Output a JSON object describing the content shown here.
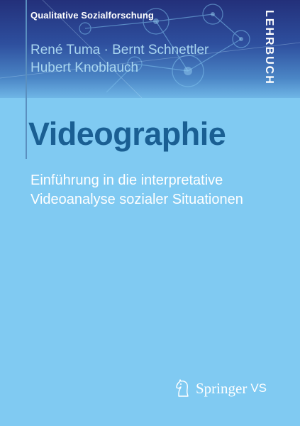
{
  "series": "Qualitative Sozialforschung",
  "badge": "LEHRBUCH",
  "authors": {
    "line1": {
      "a": "René Tuma",
      "sep": "·",
      "b": "Bernt Schnettler"
    },
    "line2": "Hubert Knoblauch"
  },
  "title": "Videographie",
  "subtitle": {
    "line1": "Einführung in die interpretative",
    "line2": "Videoanalyse sozialer Situationen"
  },
  "publisher": {
    "name": "Springer",
    "imprint": "VS",
    "icon": "chess-knight-icon"
  },
  "colors": {
    "background": "#80caf2",
    "title": "#1a5f93",
    "band_top": "#23307a",
    "band_bottom": "#6fb6e6"
  }
}
